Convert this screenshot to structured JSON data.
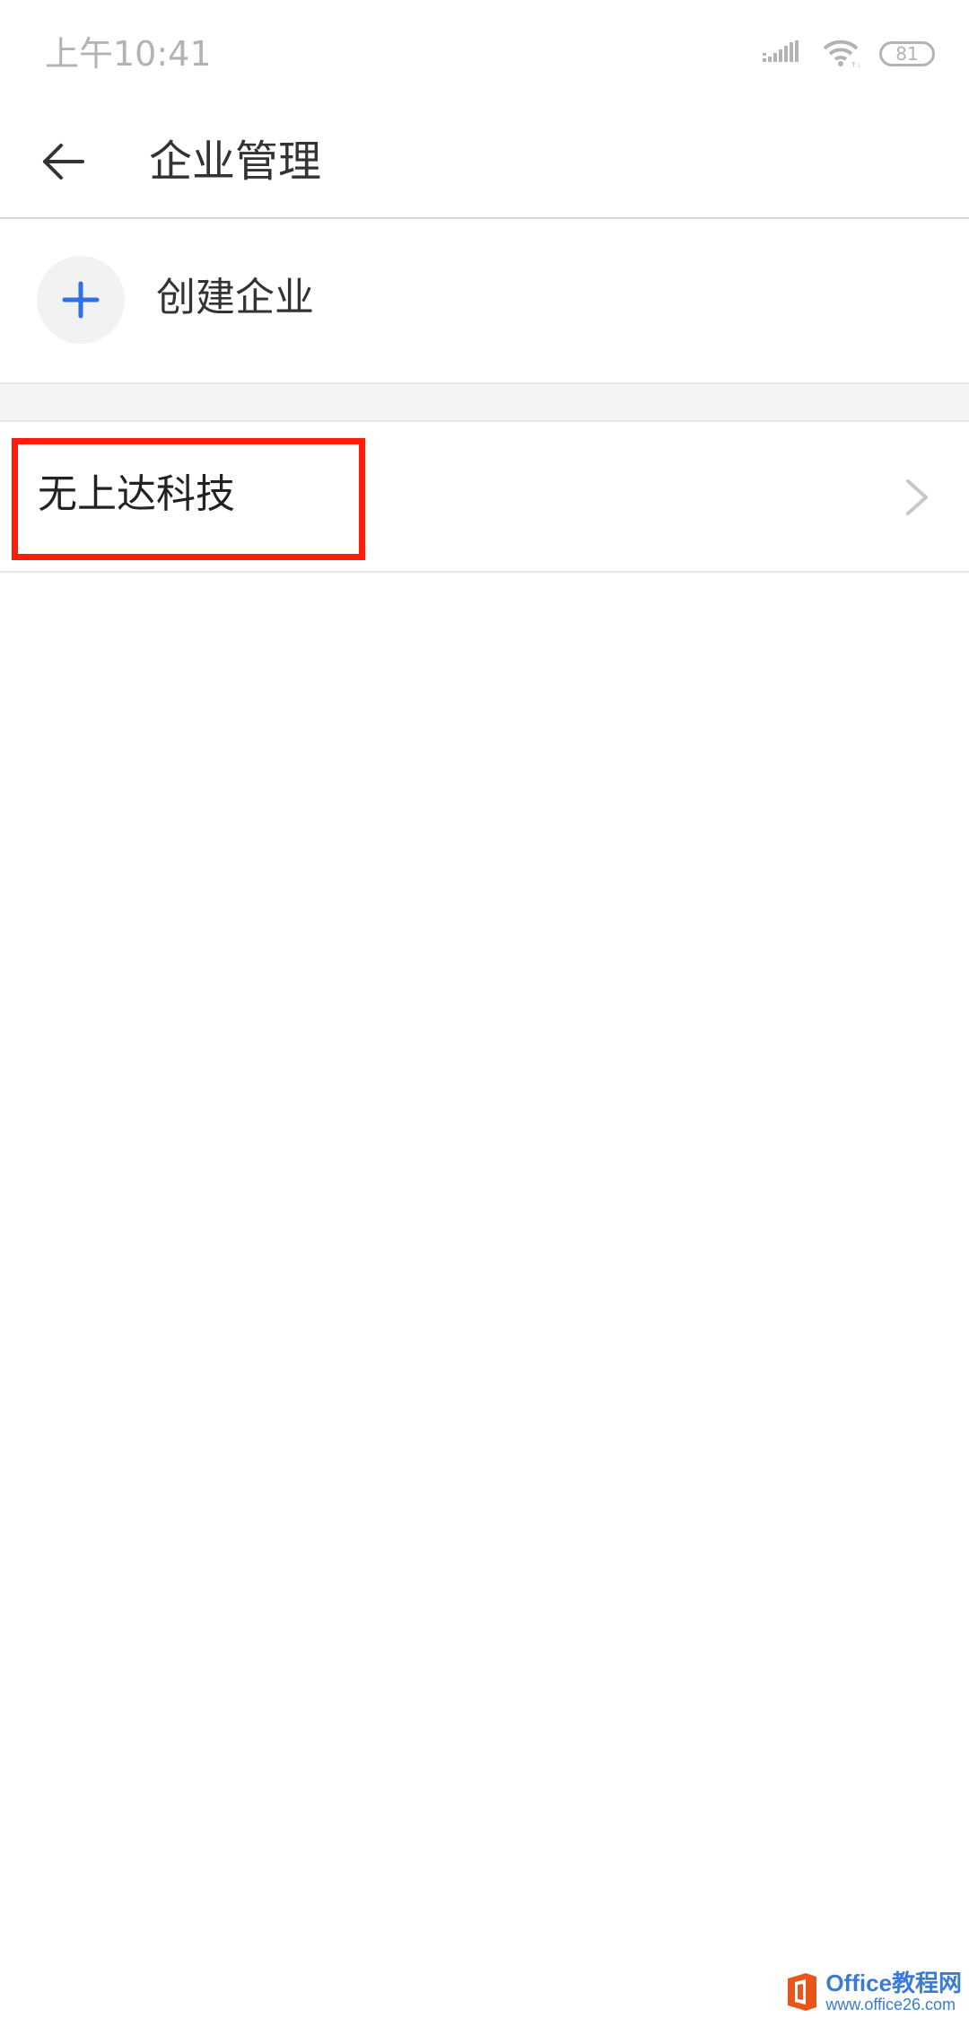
{
  "status_bar": {
    "time": "上午10:41",
    "battery_level": "81",
    "icons": [
      "signal-icon",
      "wifi-icon",
      "battery-icon"
    ]
  },
  "app_bar": {
    "back_icon": "arrow-left-icon",
    "title": "企业管理"
  },
  "create_row": {
    "icon": "plus-icon",
    "label": "创建企业"
  },
  "companies": [
    {
      "name": "无上达科技",
      "icon": "chevron-right-icon",
      "highlighted": true
    }
  ],
  "watermark": {
    "title": "Office教程网",
    "url": "www.office26.com"
  },
  "colors": {
    "accent_blue": "#2f6fe8",
    "highlight_red": "#ff1d0a",
    "status_gray": "#b3b3b3",
    "text_dark": "#333333"
  }
}
